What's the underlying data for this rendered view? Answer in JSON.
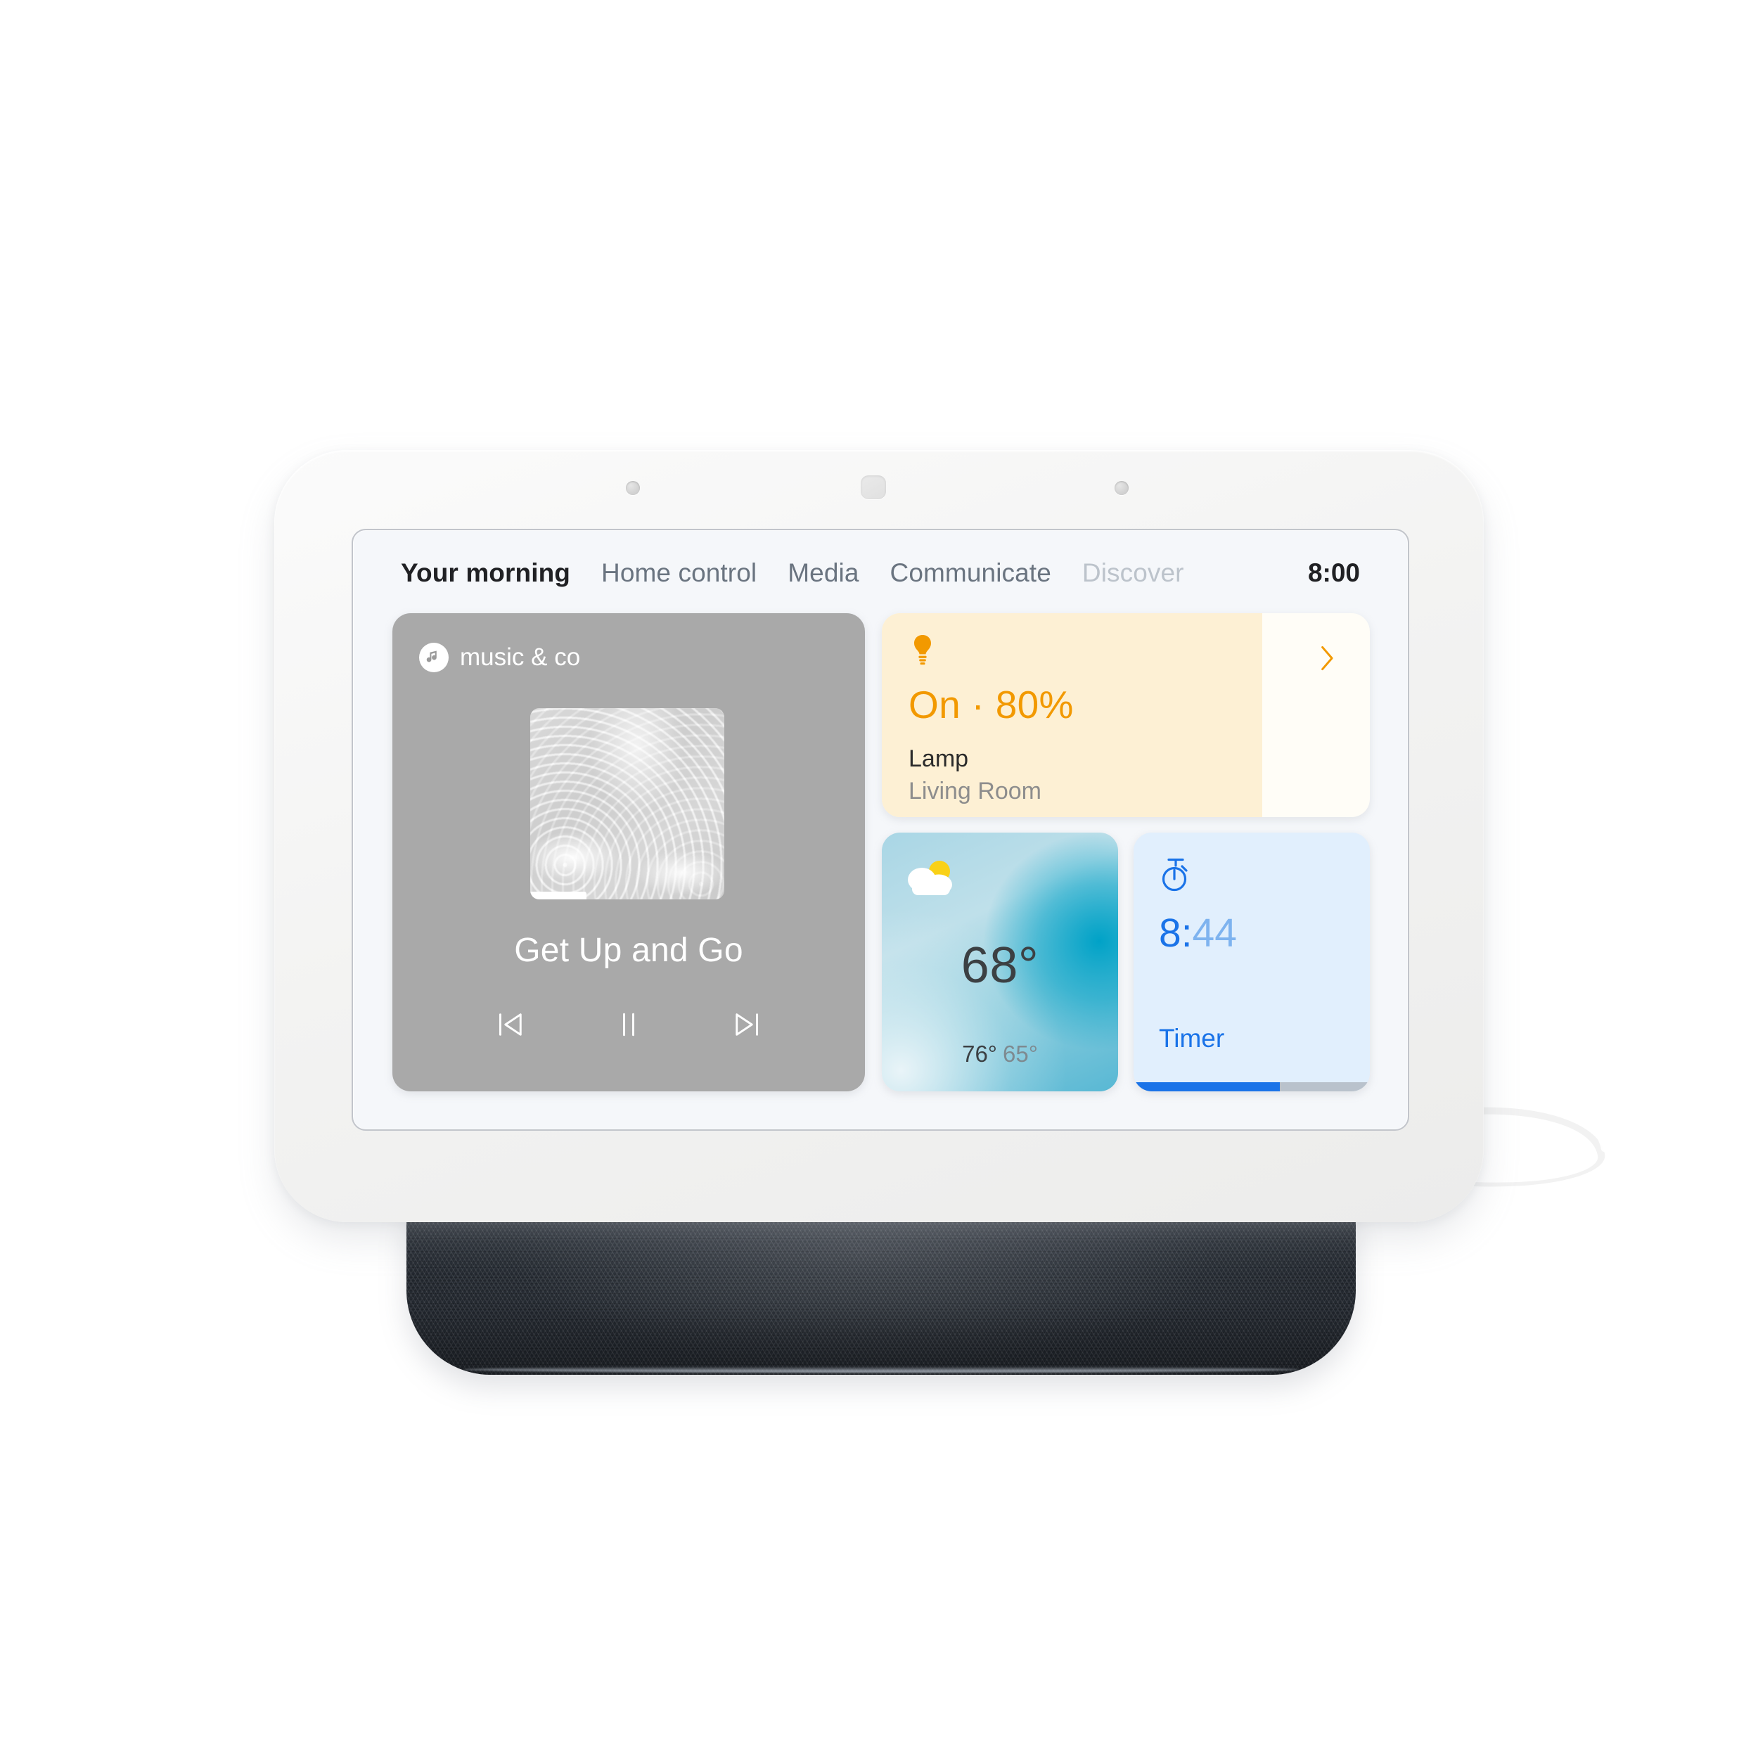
{
  "device": {
    "name": "smart-display",
    "body_color": "#f3f3f2",
    "fabric_color": "#2c323a",
    "screen_bg": "#f5f7fa"
  },
  "navbar": {
    "tabs": [
      {
        "label": "Your morning",
        "state": "active"
      },
      {
        "label": "Home control",
        "state": "normal"
      },
      {
        "label": "Media",
        "state": "normal"
      },
      {
        "label": "Communicate",
        "state": "normal"
      },
      {
        "label": "Discover",
        "state": "dim"
      }
    ],
    "clock": "8:00"
  },
  "media_card": {
    "provider": "music & co",
    "provider_icon": "music-note-icon",
    "album_art": "water-ripple-artwork",
    "progress_percent": 29,
    "track_title": "Get Up and Go",
    "controls": [
      {
        "icon": "skip-previous-icon",
        "label": "Previous"
      },
      {
        "icon": "pause-icon",
        "label": "Pause"
      },
      {
        "icon": "skip-next-icon",
        "label": "Next"
      }
    ],
    "bg_color": "#a9a9a9"
  },
  "lamp_card": {
    "icon": "light-bulb-icon",
    "state": "On · 80%",
    "brightness_percent": 80,
    "name": "Lamp",
    "room": "Living Room",
    "chevron": "chevron-right-icon",
    "accent_color": "#f29900",
    "fill_color": "#fdf0d4",
    "bg_color": "#fffdf7"
  },
  "weather_card": {
    "icon": "partly-cloudy-icon",
    "temperature": "68°",
    "high": "76°",
    "low": "65°",
    "gradient_from": "#a9d6e5",
    "gradient_to": "#00a2c7"
  },
  "timer_card": {
    "icon": "stopwatch-icon",
    "time_elapsed": "8:",
    "time_remaining": "44",
    "label": "Timer",
    "progress_percent": 62,
    "accent_color": "#1a73e8",
    "bg_color": "#e1effd"
  }
}
